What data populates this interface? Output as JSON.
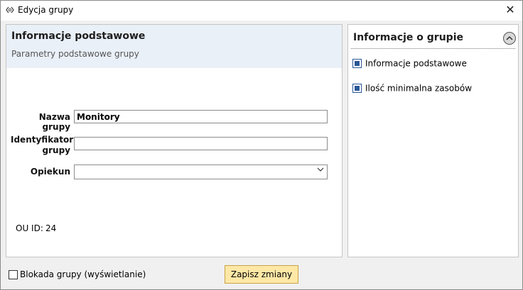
{
  "window": {
    "title": "Edycja grupy",
    "close_glyph": "✕"
  },
  "icons": {
    "app": "group-icon",
    "close": "close-icon",
    "collapse": "chevron-up-icon",
    "dropdown": "chevron-down-icon"
  },
  "basic_info": {
    "title": "Informacje podstawowe",
    "subtitle": "Parametry podstawowe grupy",
    "fields": {
      "name_label": "Nazwa grupy",
      "name_value": "Monitory",
      "identifier_label_line1": "Identyfikator",
      "identifier_label_line2": "grupy",
      "identifier_value": "",
      "guardian_label": "Opiekun",
      "guardian_value": ""
    },
    "ou_label": "OU ID:",
    "ou_value": "24"
  },
  "group_info": {
    "title": "Informacje o grupie",
    "items": [
      {
        "label": "Informacje podstawowe"
      },
      {
        "label": "Ilość minimalna zasobów"
      }
    ]
  },
  "footer": {
    "block_label": "Blokada grupy (wyświetlanie)",
    "block_checked": false,
    "save_label": "Zapisz zmiany"
  },
  "colors": {
    "header_bg": "#eaf0f8",
    "save_bg": "#ffe8a6",
    "check_blue": "#2b5797"
  }
}
